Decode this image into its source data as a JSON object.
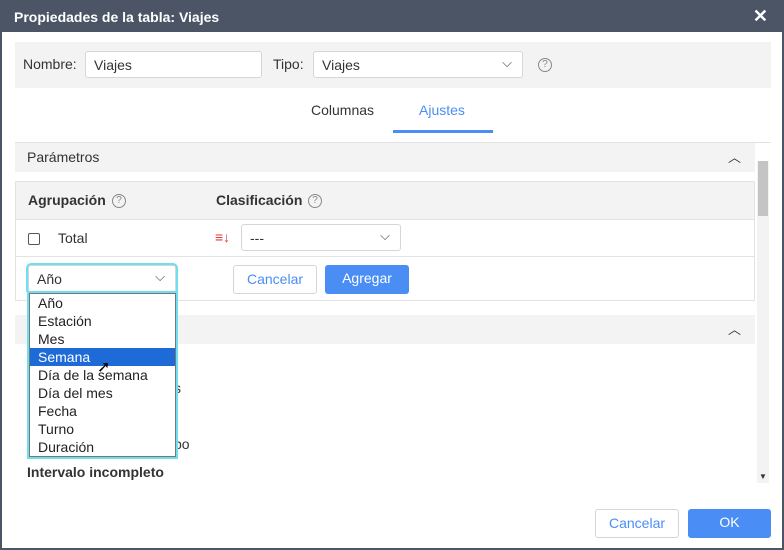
{
  "title": "Propiedades de la tabla: Viajes",
  "name_label": "Nombre:",
  "name_value": "Viajes",
  "type_label": "Tipo:",
  "type_value": "Viajes",
  "tabs": [
    "Columnas",
    "Ajustes"
  ],
  "params_title": "Parámetros",
  "grouping_header": "Agrupación",
  "sorting_header": "Clasificación",
  "total_label": "Total",
  "sort_value": "---",
  "group_select_value": "Año",
  "cancel_small": "Cancelar",
  "add": "Agregar",
  "options": [
    "Año",
    "Estación",
    "Mes",
    "Semana",
    "Día de la semana",
    "Día del mes",
    "Fecha",
    "Turno",
    "Duración"
  ],
  "partial_a": "s",
  "partial_b": "po",
  "incomplete_interval": "Intervalo incompleto",
  "footer": {
    "cancel": "Cancelar",
    "ok": "OK"
  },
  "accent": "#4a8ef5"
}
